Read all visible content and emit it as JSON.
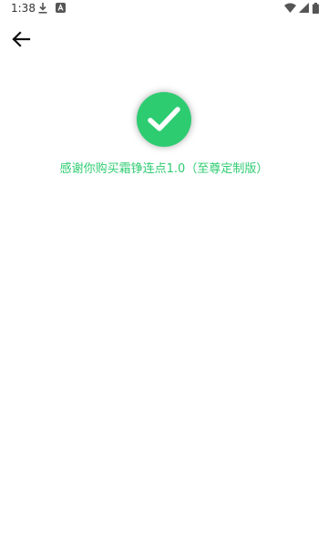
{
  "status_bar": {
    "time": "1:38",
    "icons": [
      "download-icon",
      "app-notification-icon",
      "wifi-icon",
      "signal-icon",
      "battery-icon"
    ]
  },
  "toolbar": {
    "back_icon": "arrow-left-icon"
  },
  "result": {
    "icon": "check-circle-icon",
    "message": "感谢你购买霜铮连点1.0（至尊定制版）"
  },
  "colors": {
    "accent": "#2ecc71",
    "background": "#ffffff"
  }
}
